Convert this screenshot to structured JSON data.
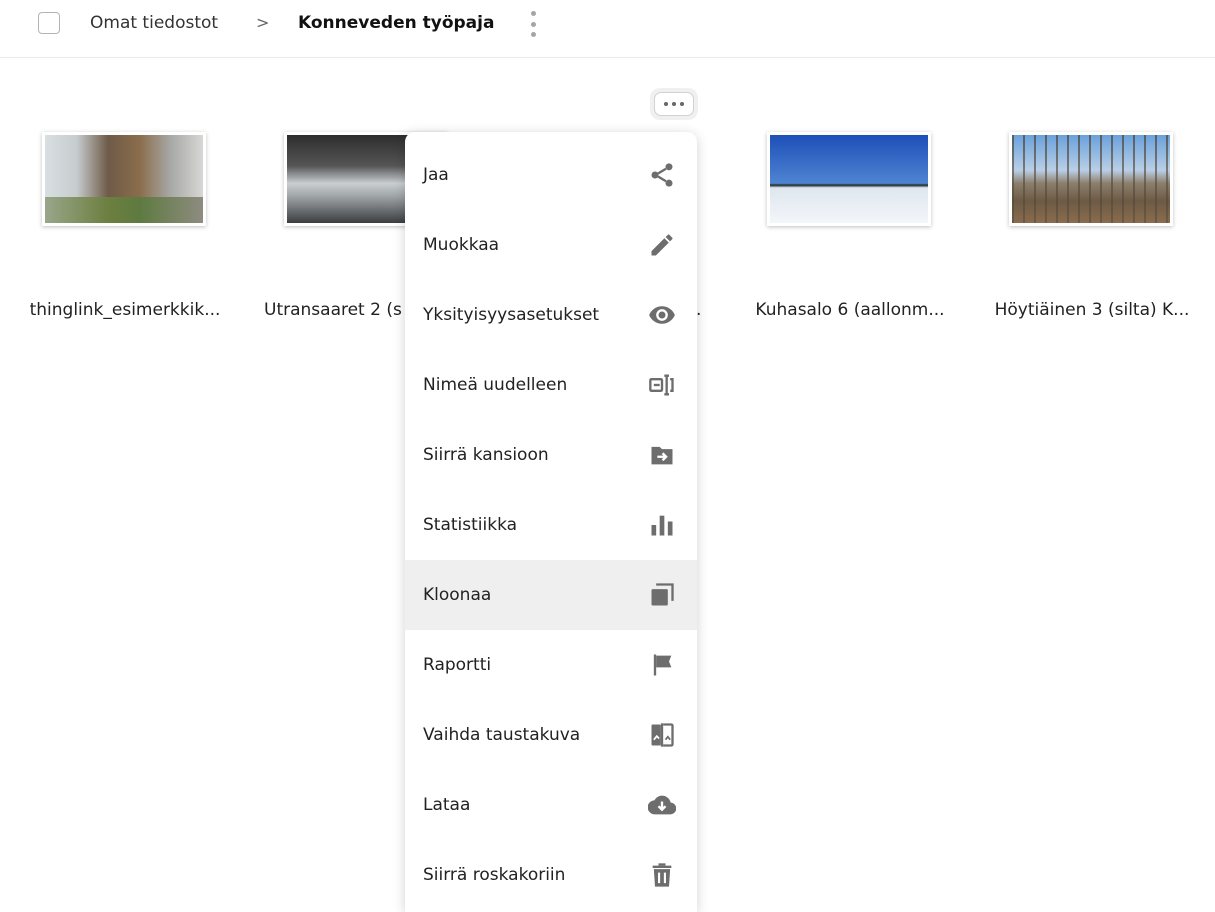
{
  "breadcrumb": {
    "root": "Omat tiedostot",
    "separator": ">",
    "current": "Konneveden työpaja"
  },
  "files": [
    {
      "title": "thinglink_esimerkkik..."
    },
    {
      "title": "Utransaaret 2 (s"
    },
    {
      "title": "Kuhasalo 6 (aallonm..."
    },
    {
      "title": "Höytiäinen 3 (silta) K..."
    }
  ],
  "hidden_title_tail": ".",
  "menu": {
    "items": [
      {
        "label": "Jaa",
        "icon": "share-icon"
      },
      {
        "label": "Muokkaa",
        "icon": "pencil-icon"
      },
      {
        "label": "Yksityisyysasetukset",
        "icon": "eye-icon"
      },
      {
        "label": "Nimeä uudelleen",
        "icon": "rename-icon"
      },
      {
        "label": "Siirrä kansioon",
        "icon": "move-folder-icon"
      },
      {
        "label": "Statistiikka",
        "icon": "bar-chart-icon"
      },
      {
        "label": "Kloonaa",
        "icon": "clone-icon"
      },
      {
        "label": "Raportti",
        "icon": "flag-icon"
      },
      {
        "label": "Vaihda taustakuva",
        "icon": "swap-image-icon"
      },
      {
        "label": "Lataa",
        "icon": "cloud-download-icon"
      },
      {
        "label": "Siirrä roskakoriin",
        "icon": "trash-icon"
      }
    ],
    "highlighted_item": "Kloonaa"
  },
  "colors": {
    "icon_gray": "#6d6d6d",
    "highlight_bg": "#efefef",
    "divider": "#ececec"
  }
}
